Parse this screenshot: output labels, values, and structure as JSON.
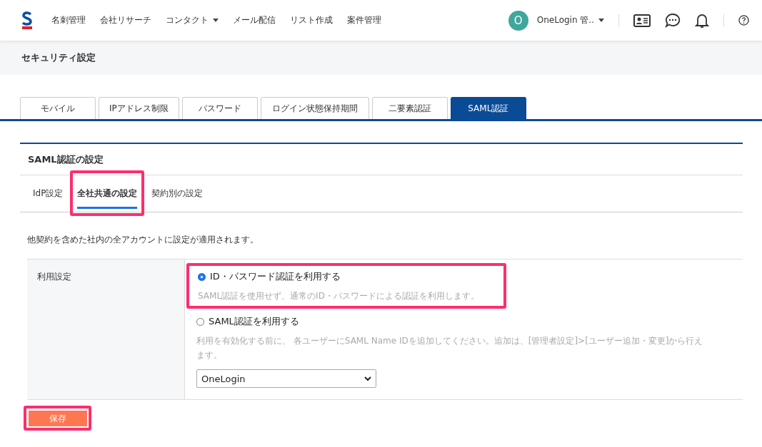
{
  "header": {
    "nav": [
      {
        "label": "名刺管理",
        "dropdown": false
      },
      {
        "label": "会社リサーチ",
        "dropdown": false
      },
      {
        "label": "コンタクト",
        "dropdown": true
      },
      {
        "label": "メール配信",
        "dropdown": false
      },
      {
        "label": "リスト作成",
        "dropdown": false
      },
      {
        "label": "案件管理",
        "dropdown": false
      }
    ],
    "user": {
      "initial": "O",
      "name": "OneLogin 管.."
    }
  },
  "page_title": "セキュリティ設定",
  "tabs": [
    {
      "label": "モバイル",
      "selected": false
    },
    {
      "label": "IPアドレス制限",
      "selected": false
    },
    {
      "label": "パスワード",
      "selected": false
    },
    {
      "label": "ログイン状態保持期間",
      "selected": false
    },
    {
      "label": "二要素認証",
      "selected": false
    },
    {
      "label": "SAML認証",
      "selected": true
    }
  ],
  "section": {
    "title": "SAML認証の設定",
    "subtabs": [
      {
        "label": "IdP設定",
        "selected": false,
        "highlighted": false
      },
      {
        "label": "全社共通の設定",
        "selected": true,
        "highlighted": true
      },
      {
        "label": "契約別の設定",
        "selected": false,
        "highlighted": false
      }
    ],
    "description": "他契約を含めた社内の全アカウントに設定が適用されます。",
    "setting": {
      "label": "利用設定",
      "options": [
        {
          "label": "ID・パスワード認証を利用する",
          "hint": "SAML認証を使用せず、通常のID・パスワードによる認証を利用します。",
          "selected": true,
          "highlighted": true
        },
        {
          "label": "SAML認証を利用する",
          "hint": "利用を有効化する前に、 各ユーザーにSAML Name IDを追加してください。追加は、[管理者設定]>[ユーザー追加・変更]から行えます。",
          "selected": false,
          "highlighted": false
        }
      ],
      "idp_select": {
        "value": "OneLogin"
      }
    }
  },
  "save_button": {
    "label": "保存",
    "highlighted": true
  }
}
